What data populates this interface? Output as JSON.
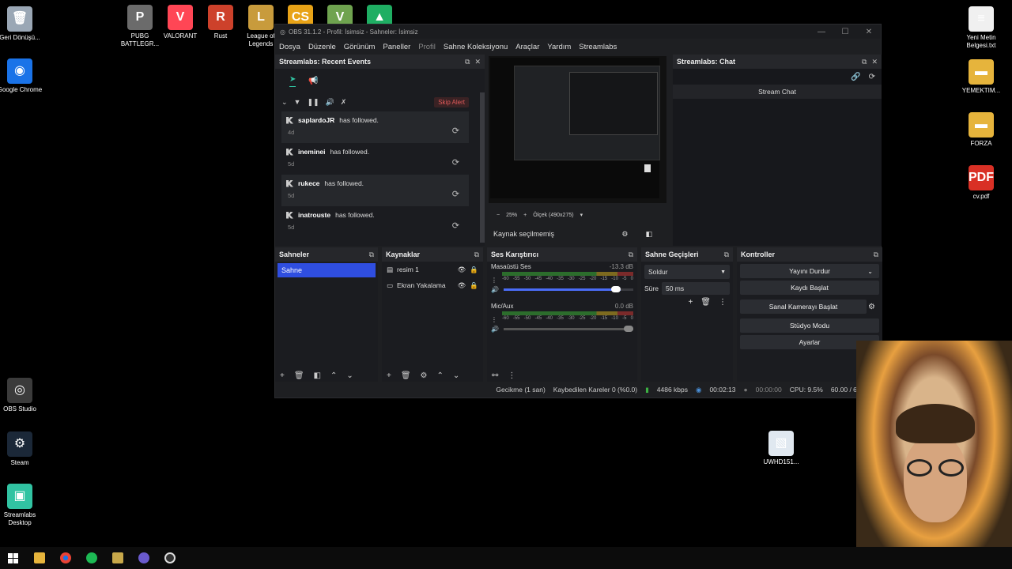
{
  "desktop_left": [
    {
      "label": "Geri Dönüşü...",
      "color": "#9aa7b5",
      "glyph": "🗑"
    },
    {
      "label": "Google Chrome",
      "color": "#1a73e8",
      "glyph": "◉"
    },
    {
      "label": "OBS Studio",
      "color": "#3b3b3b",
      "glyph": "◎"
    },
    {
      "label": "Steam",
      "color": "#1b2838",
      "glyph": "⚙"
    },
    {
      "label": "Streamlabs Desktop",
      "color": "#31c3a2",
      "glyph": "▣"
    }
  ],
  "desktop_top": [
    {
      "label": "PUBG BATTLEGR...",
      "color": "#6b6b6b",
      "glyph": "P"
    },
    {
      "label": "VALORANT",
      "color": "#ff4655",
      "glyph": "V"
    },
    {
      "label": "Rust",
      "color": "#cd412b",
      "glyph": "R"
    },
    {
      "label": "League of Legends",
      "color": "#c89b3c",
      "glyph": "L"
    },
    {
      "label": "",
      "color": "#e8a317",
      "glyph": "CS"
    },
    {
      "label": "",
      "color": "#6fa34f",
      "glyph": "V"
    },
    {
      "label": "",
      "color": "#1fae63",
      "glyph": "▲"
    }
  ],
  "desktop_right": [
    {
      "label": "Yeni Metin Belgesi.txt",
      "color": "#f0f0f0",
      "glyph": "≡"
    },
    {
      "label": "YEMEKTIM...",
      "color": "#e6b43c",
      "glyph": "▬"
    },
    {
      "label": "FORZA",
      "color": "#e6b43c",
      "glyph": "▬"
    },
    {
      "label": "cv.pdf",
      "color": "#d93025",
      "glyph": "PDF"
    },
    {
      "label": "UWHD151...",
      "color": "#e0e8f0",
      "glyph": "▧"
    }
  ],
  "obs": {
    "title": "OBS 31.1.2 - Profil: İsimsiz - Sahneler: İsimsiz",
    "menu": [
      "Dosya",
      "Düzenle",
      "Görünüm",
      "Paneller",
      "Profil",
      "Sahne Koleksiyonu",
      "Araçlar",
      "Yardım",
      "Streamlabs"
    ],
    "events": {
      "title": "Streamlabs: Recent Events",
      "skip": "Skip Alert",
      "items": [
        {
          "name": "saplardoJR",
          "action": "has followed.",
          "ago": "4d"
        },
        {
          "name": "ineminei",
          "action": "has followed.",
          "ago": "5d"
        },
        {
          "name": "rukece",
          "action": "has followed.",
          "ago": "5d"
        },
        {
          "name": "inatrouste",
          "action": "has followed.",
          "ago": "5d"
        }
      ]
    },
    "preview": {
      "zoom": "25%",
      "scale": "Ölçek (490x275)",
      "no_source": "Kaynak seçilmemiş"
    },
    "chat": {
      "title": "Streamlabs: Chat",
      "stream_chat": "Stream Chat"
    },
    "scenes": {
      "title": "Sahneler",
      "items": [
        "Sahne"
      ]
    },
    "sources": {
      "title": "Kaynaklar",
      "items": [
        "resim 1",
        "Ekran Yakalama"
      ]
    },
    "mixer": {
      "title": "Ses Karıştırıcı",
      "channels": [
        {
          "name": "Masaüstü Ses",
          "db": "-13.3 dB",
          "volume": 0.9
        },
        {
          "name": "Mic/Aux",
          "db": "0.0 dB",
          "volume": 1.0
        }
      ],
      "ticks": [
        "-60",
        "-55",
        "-50",
        "-45",
        "-40",
        "-35",
        "-30",
        "-25",
        "-20",
        "-15",
        "-10",
        "-5",
        "0"
      ]
    },
    "transitions": {
      "title": "Sahne Geçişleri",
      "type": "Soldur",
      "duration_label": "Süre",
      "duration": "50 ms"
    },
    "controls": {
      "title": "Kontroller",
      "stop_stream": "Yayını Durdur",
      "start_record": "Kaydı Başlat",
      "virtual_cam": "Sanal Kamerayı Başlat",
      "studio": "Stüdyo Modu",
      "settings": "Ayarlar"
    },
    "status": {
      "delay": "Gecikme (1 san)",
      "dropped": "Kaybedilen Kareler 0 (%0.0)",
      "bitrate": "4486 kbps",
      "live_time": "00:02:13",
      "rec_time": "00:00:00",
      "cpu": "CPU: 9.5%",
      "fps": "60.00 / 60.00 F"
    }
  },
  "colors": {
    "accent": "#2f4ee0",
    "streamlabs": "#31c3a2",
    "skip": "#e05a5a"
  }
}
